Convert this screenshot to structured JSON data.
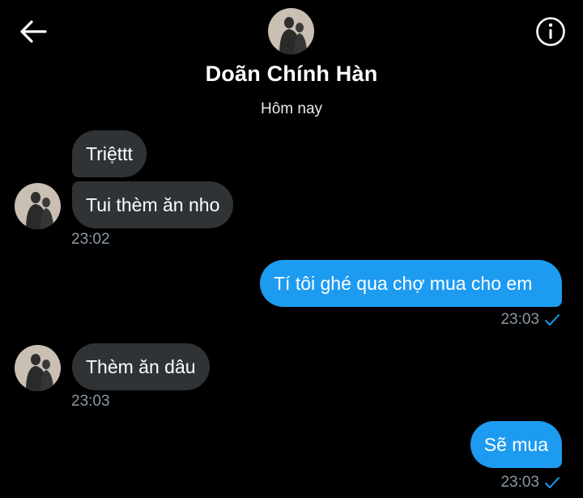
{
  "header": {
    "contact_name": "Doãn Chính Hàn",
    "date_separator": "Hôm nay",
    "back_icon": "arrow-left-icon",
    "info_icon": "info-circle-icon"
  },
  "messages": [
    {
      "direction": "incoming",
      "text": "Triệttt"
    },
    {
      "direction": "incoming",
      "text": "Tui thèm ăn nho",
      "time": "23:02"
    },
    {
      "direction": "outgoing",
      "text": "Tí tôi ghé qua chợ mua cho em",
      "time": "23:03",
      "status_icon": "check-icon"
    },
    {
      "direction": "incoming",
      "text": "Thèm ăn dâu",
      "time": "23:03"
    },
    {
      "direction": "outgoing",
      "text": "Sẽ mua",
      "time": "23:03",
      "status_icon": "check-icon"
    }
  ],
  "colors": {
    "background": "#000000",
    "incoming_bubble": "#2f3336",
    "outgoing_bubble": "#1d9bf0",
    "timestamp": "#8b98a5",
    "read_check": "#1d9bf0"
  }
}
